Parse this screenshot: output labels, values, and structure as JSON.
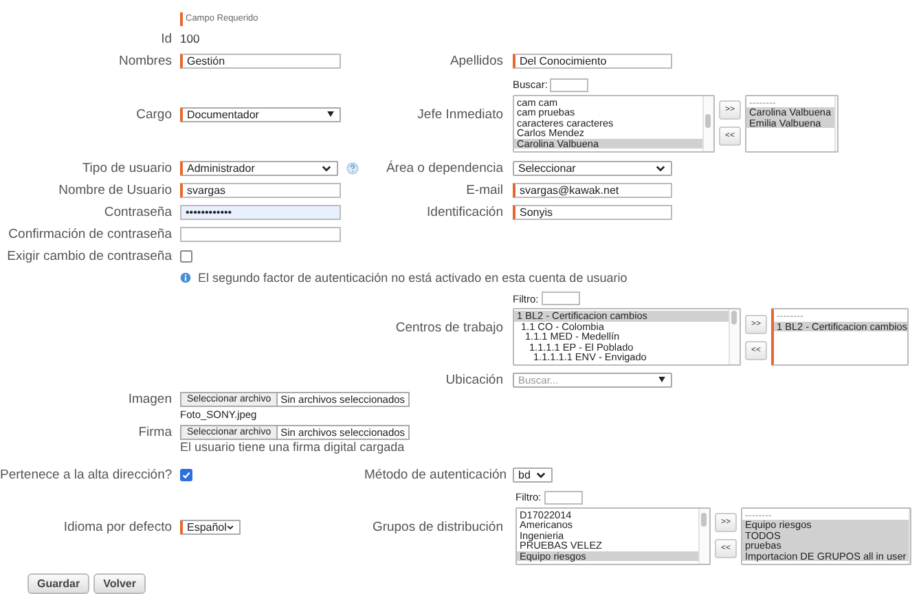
{
  "required_note": "Campo Requerido",
  "id": {
    "label": "Id",
    "value": "100"
  },
  "nombres": {
    "label": "Nombres",
    "value": "Gestión",
    "required": true
  },
  "apellidos": {
    "label": "Apellidos",
    "value": "Del Conocimiento",
    "required": true
  },
  "cargo": {
    "label": "Cargo",
    "value": "Documentador",
    "required": true,
    "kind": "combo"
  },
  "jefe_inmediato": {
    "label": "Jefe Inmediato",
    "search_label": "Buscar:",
    "add_button": ">>",
    "remove_button": "<<",
    "required": false,
    "available": [
      {
        "text": "cam cam",
        "selected": false
      },
      {
        "text": "cam pruebas",
        "selected": false
      },
      {
        "text": "caracteres caracteres",
        "selected": false
      },
      {
        "text": "Carlos Mendez",
        "selected": false
      },
      {
        "text": "Carolina Valbuena",
        "selected": true
      }
    ],
    "chosen": [
      {
        "text": "--------",
        "selected": false
      },
      {
        "text": "Carolina Valbuena",
        "selected": true
      },
      {
        "text": "Emilia Valbuena",
        "selected": true
      }
    ]
  },
  "tipo_usuario": {
    "label": "Tipo de usuario",
    "value": "Administrador",
    "required": true,
    "kind": "select"
  },
  "area": {
    "label": "Área o dependencia",
    "value": "Seleccionar",
    "required": false,
    "kind": "select"
  },
  "nombre_usuario": {
    "label": "Nombre de Usuario",
    "value": "svargas",
    "required": true
  },
  "email": {
    "label": "E-mail",
    "value": "svargas@kawak.net",
    "required": true
  },
  "contrasena": {
    "label": "Contraseña",
    "value": "••••••••••••",
    "required": false,
    "autofilled": true
  },
  "identificacion": {
    "label": "Identificación",
    "value": "Sonyis",
    "required": true
  },
  "confirmacion": {
    "label": "Confirmación de contraseña",
    "required": false
  },
  "exigir_cambio": {
    "label": "Exigir cambio de contraseña",
    "checked": false
  },
  "info_message": "El segundo factor de autenticación no está activado en esta cuenta de usuario",
  "centros": {
    "label": "Centros de trabajo",
    "search_label": "Filtro:",
    "add_button": ">>",
    "remove_button": "<<",
    "required": true,
    "available": [
      {
        "text": "1 BL2 - Certificacion cambios",
        "selected": true,
        "children": [
          {
            "text": "1.1 CO - Colombia",
            "selected": false,
            "children": [
              {
                "text": "1.1.1 MED - Medellín",
                "selected": false,
                "children": [
                  {
                    "text": "1.1.1.1 EP - El Poblado",
                    "selected": false,
                    "children": [
                      {
                        "text": "1.1.1.1.1 ENV - Envigado",
                        "selected": false
                      }
                    ]
                  }
                ]
              }
            ]
          }
        ]
      }
    ],
    "chosen": [
      {
        "text": "--------",
        "selected": false
      },
      {
        "text": "1 BL2 - Certificacion cambios",
        "selected": true
      }
    ]
  },
  "ubicacion": {
    "label": "Ubicación",
    "placeholder": "Buscar...",
    "required": false,
    "kind": "combo"
  },
  "imagen": {
    "label": "Imagen",
    "button": "Seleccionar archivo",
    "status": "Sin archivos seleccionados",
    "note": "Foto_SONY.jpeg"
  },
  "firma": {
    "label": "Firma",
    "button": "Seleccionar archivo",
    "status": "Sin archivos seleccionados",
    "note": "El usuario tiene una firma digital cargada"
  },
  "alta_direccion": {
    "label": "Pertenece a la alta dirección?",
    "checked": true
  },
  "metodo": {
    "label": "Método de autenticación",
    "value": "bd",
    "required": false,
    "kind": "select"
  },
  "idioma": {
    "label": "Idioma por defecto",
    "value": "Español",
    "required": true,
    "kind": "select"
  },
  "grupos": {
    "label": "Grupos de distribución",
    "search_label": "Filtro:",
    "add_button": ">>",
    "remove_button": "<<",
    "required": false,
    "available": [
      {
        "text": "D17022014",
        "selected": false
      },
      {
        "text": "Americanos",
        "selected": false
      },
      {
        "text": "Ingenieria",
        "selected": false
      },
      {
        "text": "PRUEBAS VELEZ",
        "selected": false
      },
      {
        "text": "Equipo riesgos",
        "selected": true
      }
    ],
    "chosen": [
      {
        "text": "--------",
        "selected": false
      },
      {
        "text": "Equipo riesgos",
        "selected": true
      },
      {
        "text": "TODOS",
        "selected": true
      },
      {
        "text": "pruebas",
        "selected": true
      },
      {
        "text": "Importacion DE GRUPOS all in user",
        "selected": true
      }
    ]
  },
  "buttons": [
    "Guardar",
    "Volver"
  ]
}
